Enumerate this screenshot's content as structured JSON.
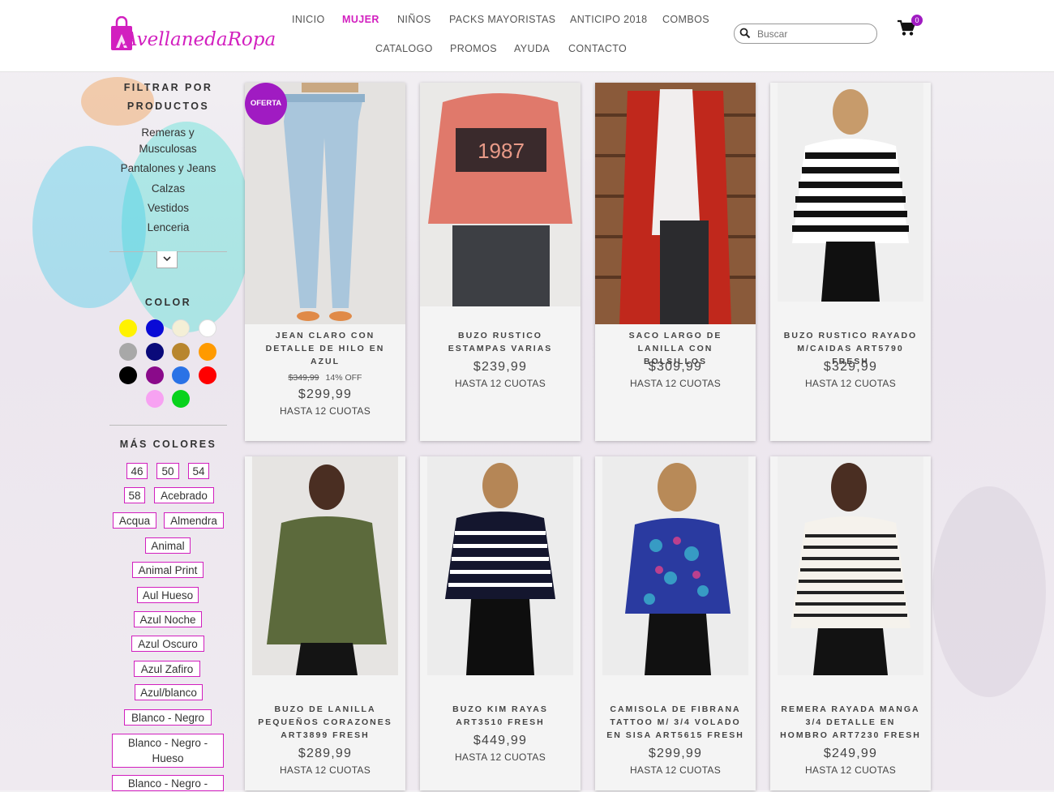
{
  "header": {
    "brand": "AvellanedaRopa",
    "nav_row1": [
      "INICIO",
      "MUJER",
      "NIÑOS",
      "PACKS MAYORISTAS",
      "ANTICIPO 2018",
      "COMBOS"
    ],
    "nav_row2": [
      "CATALOGO",
      "PROMOS",
      "AYUDA",
      "CONTACTO"
    ],
    "active_nav": "MUJER",
    "search_placeholder": "Buscar",
    "cart_count": "0"
  },
  "sidebar": {
    "filter_title_1": "FILTRAR POR",
    "filter_title_2": "PRODUCTOS",
    "categories": [
      "Remeras y Musculosas",
      "Pantalones y Jeans",
      "Calzas",
      "Vestidos",
      "Lenceria"
    ],
    "color_title": "COLOR",
    "swatches": [
      "#fff200",
      "#0a0ad6",
      "#f4efd6",
      "#ffffff",
      "#a8a8a8",
      "#0a0a7a",
      "#b8862e",
      "#ff9a00",
      "#000000",
      "#8a0a8a",
      "#2a72e6",
      "#ff0000",
      "#f7a2f2",
      "#08d21c"
    ],
    "more_colors_title": "MÁS COLORES",
    "more_colors": [
      "46",
      "50",
      "54",
      "58",
      "Acebrado",
      "Acqua",
      "Almendra",
      "Animal",
      "Animal Print",
      "Aul Hueso",
      "Azul Noche",
      "Azul Oscuro",
      "Azul Zafiro",
      "Azul/blanco",
      "Blanco - Negro",
      "Blanco - Negro - Hueso",
      "Blanco - Negro -"
    ]
  },
  "products": [
    {
      "name": "JEAN CLARO CON DETALLE DE HILO EN AZUL",
      "badge": "OFERTA",
      "old_price": "$349,99",
      "discount": "14% OFF",
      "price": "$299,99",
      "installments": "HASTA 12 CUOTAS"
    },
    {
      "name": "BUZO RUSTICO ESTAMPAS VARIAS",
      "print": "1987",
      "price": "$239,99",
      "installments": "HASTA 12 CUOTAS"
    },
    {
      "name": "SACO LARGO DE LANILLA CON BOLSILLOS",
      "price": "$309,99",
      "installments": "HASTA 12 CUOTAS"
    },
    {
      "name": "BUZO RUSTICO RAYADO M/CAIDAS ART5790 FRESH",
      "price": "$329,99",
      "installments": "HASTA 12 CUOTAS"
    },
    {
      "name": "BUZO DE LANILLA PEQUEÑOS CORAZONES ART3899 FRESH",
      "price": "$289,99",
      "installments": "HASTA 12 CUOTAS"
    },
    {
      "name": "BUZO KIM RAYAS ART3510 FRESH",
      "price": "$449,99",
      "installments": "HASTA 12 CUOTAS"
    },
    {
      "name": "CAMISOLA DE FIBRANA TATTOO M/ 3/4 VOLADO EN SISA ART5615 FRESH",
      "price": "$299,99",
      "installments": "HASTA 12 CUOTAS"
    },
    {
      "name": "REMERA RAYADA MANGA 3/4 DETALLE EN HOMBRO ART7230 FRESH",
      "price": "$249,99",
      "installments": "HASTA 12 CUOTAS"
    }
  ],
  "colors": {
    "brand": "#d21fbf",
    "badge": "#a01bc2"
  }
}
